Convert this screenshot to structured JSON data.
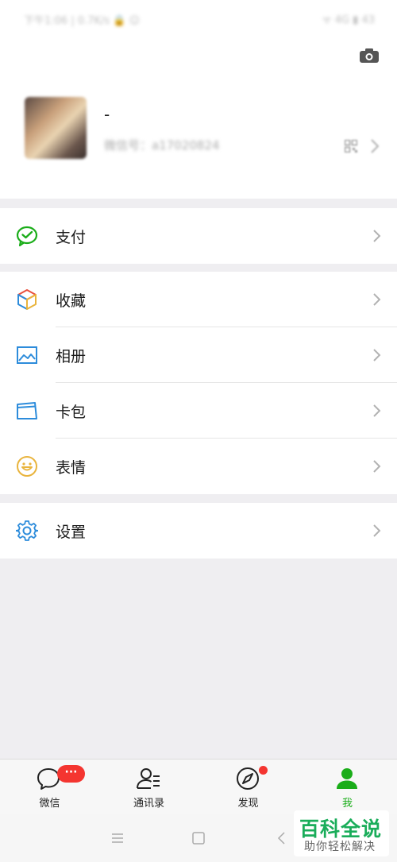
{
  "status_bar": {
    "left_text": "下午1:06 | 0.7K/s 🔒 ☺",
    "right_text": "ᯤ 4G ▮ 43"
  },
  "profile": {
    "nickname": "-",
    "wechat_id": "微信号：a17020824",
    "camera_icon": "camera-icon",
    "qr_icon": "qr-code-icon"
  },
  "menu": {
    "pay": {
      "label": "支付",
      "icon": "wechat-pay-icon",
      "color": "#1aad19"
    },
    "favorites": {
      "label": "收藏",
      "icon": "cube-icon"
    },
    "album": {
      "label": "相册",
      "icon": "image-icon",
      "color": "#2d8cdb"
    },
    "cards": {
      "label": "卡包",
      "icon": "card-icon",
      "color": "#2d8cdb"
    },
    "stickers": {
      "label": "表情",
      "icon": "smiley-icon",
      "color": "#e9b43d"
    },
    "settings": {
      "label": "设置",
      "icon": "gear-icon",
      "color": "#2d8cdb"
    }
  },
  "tabbar": {
    "chats": {
      "label": "微信",
      "badge": "···"
    },
    "contacts": {
      "label": "通讯录"
    },
    "discover": {
      "label": "发现"
    },
    "me": {
      "label": "我",
      "active_color": "#1aad19"
    }
  },
  "watermark": {
    "title": "百科全说",
    "subtitle": "助你轻松解决"
  }
}
